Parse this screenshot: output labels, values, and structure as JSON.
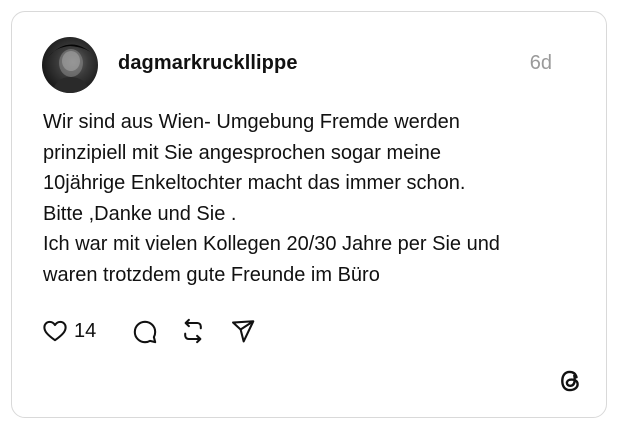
{
  "post": {
    "username": "dagmarkruckllippe",
    "time": "6d",
    "lines": [
      "Wir sind aus Wien- Umgebung Fremde werden",
      "prinzipiell mit Sie angesprochen sogar meine",
      "10jährige Enkeltochter macht das immer schon.",
      "Bitte ,Danke und Sie .",
      "Ich war mit vielen Kollegen 20/30 Jahre per Sie und",
      "waren trotzdem gute Freunde im Büro"
    ]
  },
  "actions": {
    "like_count": "14",
    "icons": [
      "heart-icon",
      "comment-icon",
      "repost-icon",
      "share-icon"
    ]
  },
  "branding": {
    "logo_icon": "threads-logo-icon"
  },
  "colors": {
    "text": "#111111",
    "muted": "#9a9a9a",
    "border": "#d9d9d9"
  }
}
